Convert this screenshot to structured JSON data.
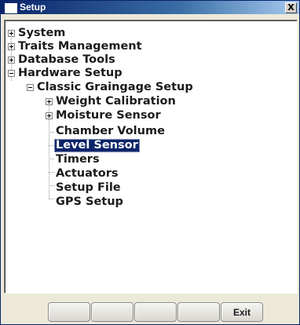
{
  "window": {
    "title": "Setup",
    "close_label": "X"
  },
  "tree": {
    "system": "System",
    "traits_management": "Traits Management",
    "database_tools": "Database Tools",
    "hardware_setup": "Hardware Setup",
    "classic_graingage_setup": "Classic Graingage Setup",
    "weight_calibration": "Weight Calibration",
    "moisture_sensor": "Moisture Sensor",
    "chamber_volume": "Chamber Volume",
    "level_sensor": "Level Sensor",
    "timers": "Timers",
    "actuators": "Actuators",
    "setup_file": "Setup File",
    "gps_setup": "GPS Setup",
    "selected_item": "Level Sensor"
  },
  "bottom_buttons": [
    "",
    "",
    "",
    "",
    "Exit"
  ],
  "colors": {
    "title_bar": "#0a246a",
    "selection": "#0a246a",
    "window_bg": "#ece9d8"
  }
}
